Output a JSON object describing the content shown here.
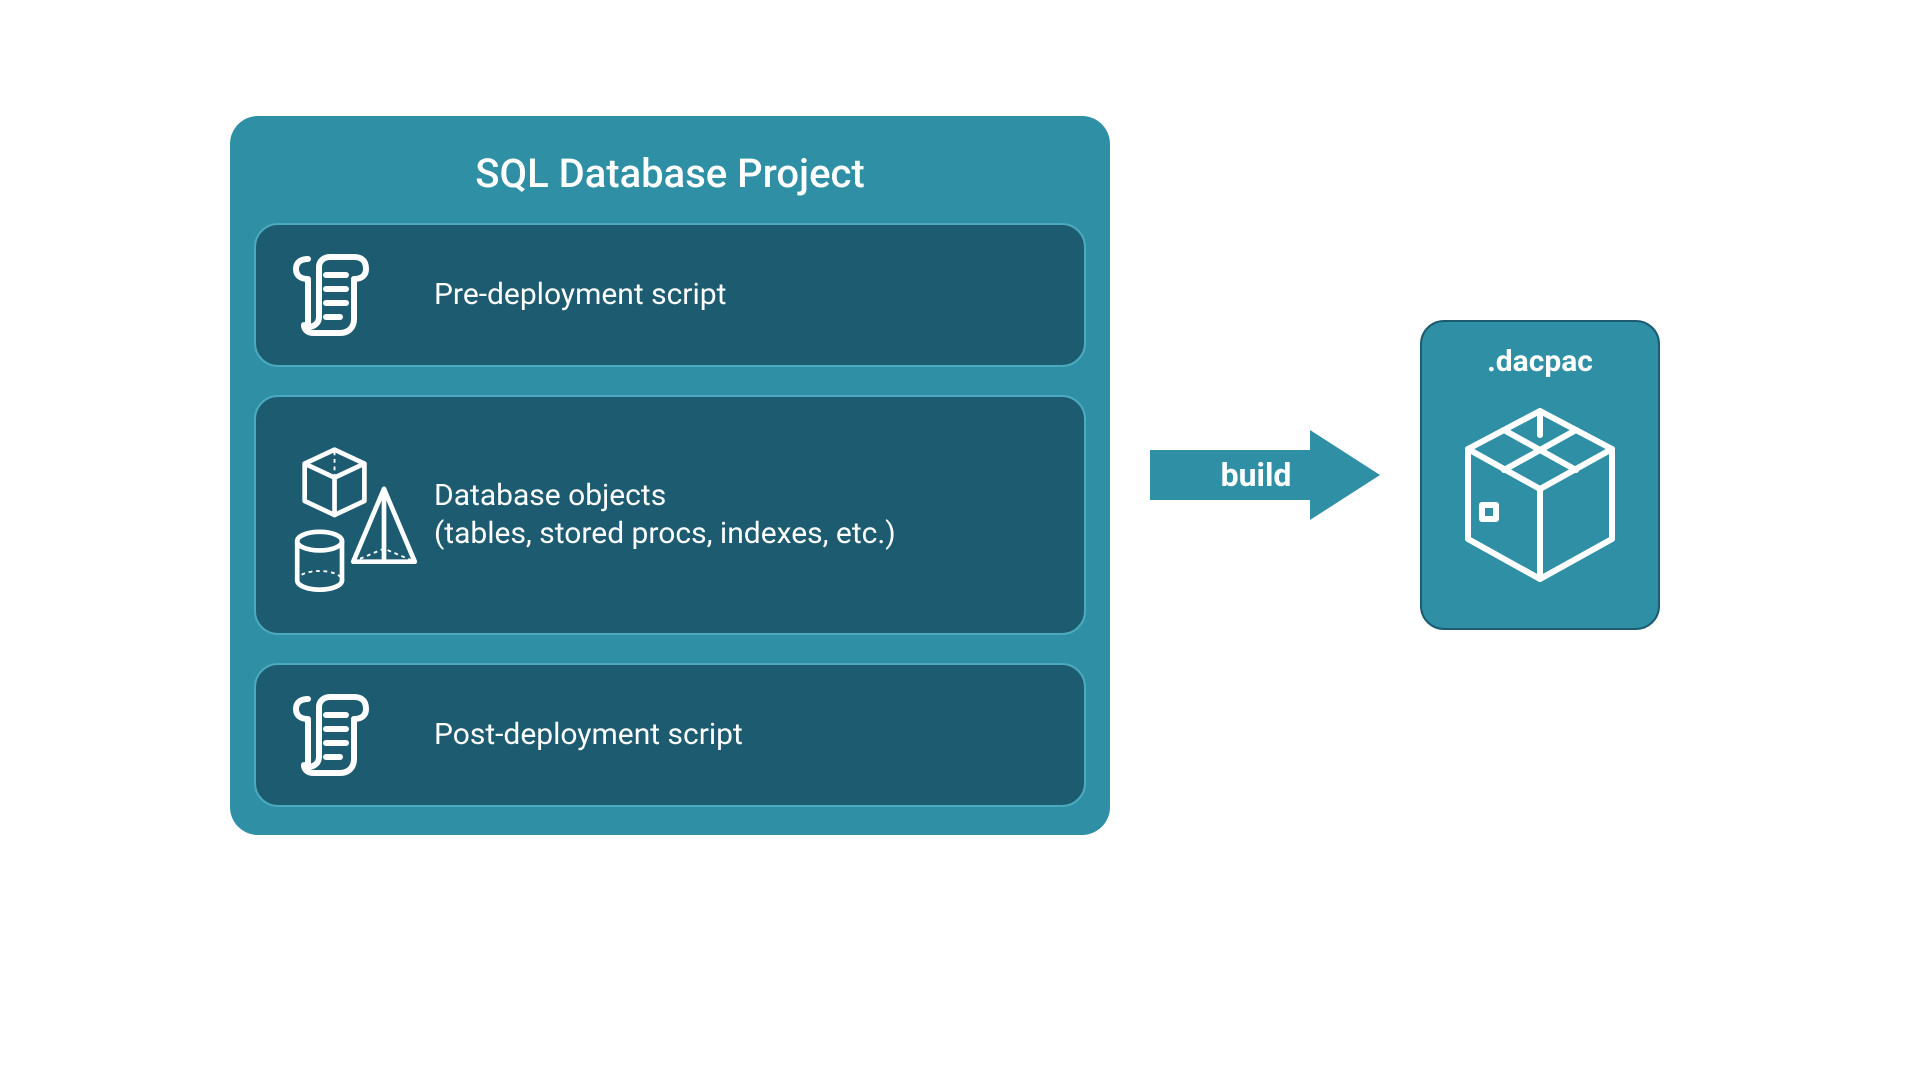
{
  "colors": {
    "container": "#2E8FA5",
    "card": "#1C5B70",
    "cardBorder": "#4CA9BE",
    "text": "#ffffff"
  },
  "project": {
    "title": "SQL Database Project",
    "items": [
      {
        "label": "Pre-deployment script"
      },
      {
        "label": "Database objects",
        "sublabel": "(tables, stored procs, indexes, etc.)"
      },
      {
        "label": "Post-deployment script"
      }
    ]
  },
  "arrow": {
    "label": "build"
  },
  "output": {
    "title": ".dacpac"
  }
}
